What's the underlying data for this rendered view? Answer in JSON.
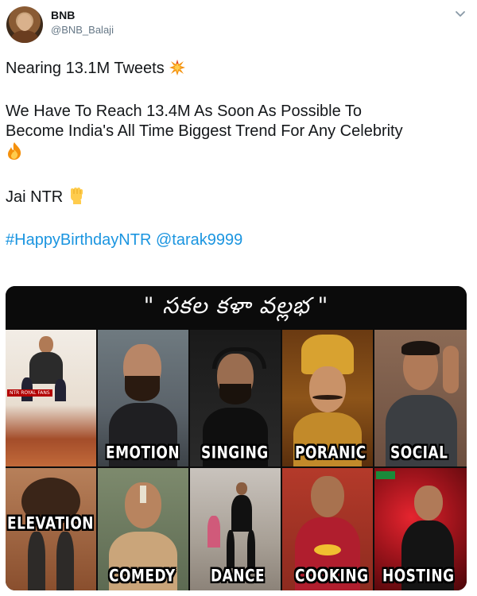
{
  "tweet": {
    "author_name": "BNB",
    "author_handle": "@BNB_Balaji",
    "line1": "Nearing 13.1M Tweets",
    "line2": "We Have To Reach 13.4M As Soon As Possible To",
    "line3": "Become India's All Time Biggest Trend For Any Celebrity",
    "line5": "Jai NTR",
    "hashtag": "#HappyBirthdayNTR",
    "mention": "@tarak9999",
    "emoji_1": "collision-emoji",
    "emoji_2": "fire-emoji",
    "emoji_3": "raised-fist-emoji"
  },
  "media": {
    "banner_title": "\" సకల కళా వల్లభ \"",
    "small_tag": "NTR ROYAL FANS",
    "captions": {
      "emotion": "EMOTION",
      "singing": "SINGING",
      "poranic": "PORANIC",
      "social": "SOCIAL",
      "elevation": "ELEVATION",
      "comedy": "COMEDY",
      "dance": "DANCE",
      "cooking": "COOKING",
      "hosting": "HOSTING"
    }
  },
  "colors": {
    "link": "#1b95e0",
    "text": "#14171a",
    "secondary": "#657786",
    "caption": "#ffffff"
  }
}
